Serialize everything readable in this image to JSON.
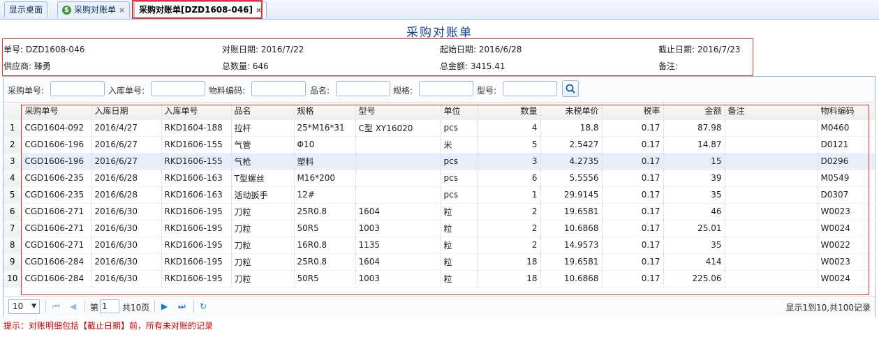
{
  "tabs": [
    {
      "label": "显示桌面"
    },
    {
      "label": "采购对账单",
      "icon": "dollar-icon"
    },
    {
      "label": "采购对账单[DZD1608-046]"
    }
  ],
  "tab_close_symbol": "×",
  "page_title": "采购对账单",
  "header": {
    "order_no": "单号: DZD1608-046",
    "recon_date": "对账日期: 2016/7/22",
    "start_date": "起始日期: 2016/6/28",
    "end_date": "截止日期: 2016/7/23",
    "supplier": "供应商: 臻勇",
    "total_qty": "总数量: 646",
    "total_amount": "总金额: 3415.41",
    "remark": "备注:"
  },
  "filters": {
    "po_no": "采购单号:",
    "in_no": "入库单号:",
    "material_code": "物料编码:",
    "name": "品名:",
    "spec": "规格:",
    "model": "型号:"
  },
  "columns": [
    "采购单号",
    "入库日期",
    "入库单号",
    "品名",
    "规格",
    "型号",
    "单位",
    "数量",
    "未税单价",
    "税率",
    "金额",
    "备注",
    "物料编码"
  ],
  "rows": [
    {
      "n": "1",
      "po": "CGD1604-092",
      "date": "2016/4/27",
      "in": "RKD1604-188",
      "name": "拉杆",
      "spec": "25*M16*31",
      "model": "C型 XY16020",
      "unit": "pcs",
      "qty": "4",
      "price": "18.8",
      "tax": "0.17",
      "amount": "87.98",
      "remark": "",
      "code": "M0460"
    },
    {
      "n": "2",
      "po": "CGD1606-196",
      "date": "2016/6/27",
      "in": "RKD1606-155",
      "name": "气管",
      "spec": "Φ10",
      "model": "",
      "unit": "米",
      "qty": "5",
      "price": "2.5427",
      "tax": "0.17",
      "amount": "14.87",
      "remark": "",
      "code": "D0121"
    },
    {
      "n": "3",
      "po": "CGD1606-196",
      "date": "2016/6/27",
      "in": "RKD1606-155",
      "name": "气枪",
      "spec": "塑料",
      "model": "",
      "unit": "pcs",
      "qty": "3",
      "price": "4.2735",
      "tax": "0.17",
      "amount": "15",
      "remark": "",
      "code": "D0296"
    },
    {
      "n": "4",
      "po": "CGD1606-235",
      "date": "2016/6/28",
      "in": "RKD1606-163",
      "name": "T型螺丝",
      "spec": "M16*200",
      "model": "",
      "unit": "pcs",
      "qty": "6",
      "price": "5.5556",
      "tax": "0.17",
      "amount": "39",
      "remark": "",
      "code": "M0549"
    },
    {
      "n": "5",
      "po": "CGD1606-235",
      "date": "2016/6/28",
      "in": "RKD1606-163",
      "name": "活动扳手",
      "spec": "12#",
      "model": "",
      "unit": "pcs",
      "qty": "1",
      "price": "29.9145",
      "tax": "0.17",
      "amount": "35",
      "remark": "",
      "code": "D0307"
    },
    {
      "n": "6",
      "po": "CGD1606-271",
      "date": "2016/6/30",
      "in": "RKD1606-195",
      "name": "刀粒",
      "spec": "25R0.8",
      "model": "1604",
      "unit": "粒",
      "qty": "2",
      "price": "19.6581",
      "tax": "0.17",
      "amount": "46",
      "remark": "",
      "code": "W0023"
    },
    {
      "n": "7",
      "po": "CGD1606-271",
      "date": "2016/6/30",
      "in": "RKD1606-195",
      "name": "刀粒",
      "spec": "50R5",
      "model": "1003",
      "unit": "粒",
      "qty": "2",
      "price": "10.6868",
      "tax": "0.17",
      "amount": "25.01",
      "remark": "",
      "code": "W0024"
    },
    {
      "n": "8",
      "po": "CGD1606-271",
      "date": "2016/6/30",
      "in": "RKD1606-195",
      "name": "刀粒",
      "spec": "16R0.8",
      "model": "1135",
      "unit": "粒",
      "qty": "2",
      "price": "14.9573",
      "tax": "0.17",
      "amount": "35",
      "remark": "",
      "code": "W0022"
    },
    {
      "n": "9",
      "po": "CGD1606-284",
      "date": "2016/6/30",
      "in": "RKD1606-195",
      "name": "刀粒",
      "spec": "25R0.8",
      "model": "1604",
      "unit": "粒",
      "qty": "18",
      "price": "19.6581",
      "tax": "0.17",
      "amount": "414",
      "remark": "",
      "code": "W0023"
    },
    {
      "n": "10",
      "po": "CGD1606-284",
      "date": "2016/6/30",
      "in": "RKD1606-195",
      "name": "刀粒",
      "spec": "50R5",
      "model": "1003",
      "unit": "粒",
      "qty": "18",
      "price": "10.6868",
      "tax": "0.17",
      "amount": "225.06",
      "remark": "",
      "code": "W0024"
    }
  ],
  "selected_row": 3,
  "pager": {
    "page_size": "10",
    "page_prefix": "第",
    "page_value": "1",
    "page_total": "共10页",
    "summary": "显示1到10,共100记录"
  },
  "hint": "提示：对账明细包括【截止日期】前，所有未对账的记录"
}
